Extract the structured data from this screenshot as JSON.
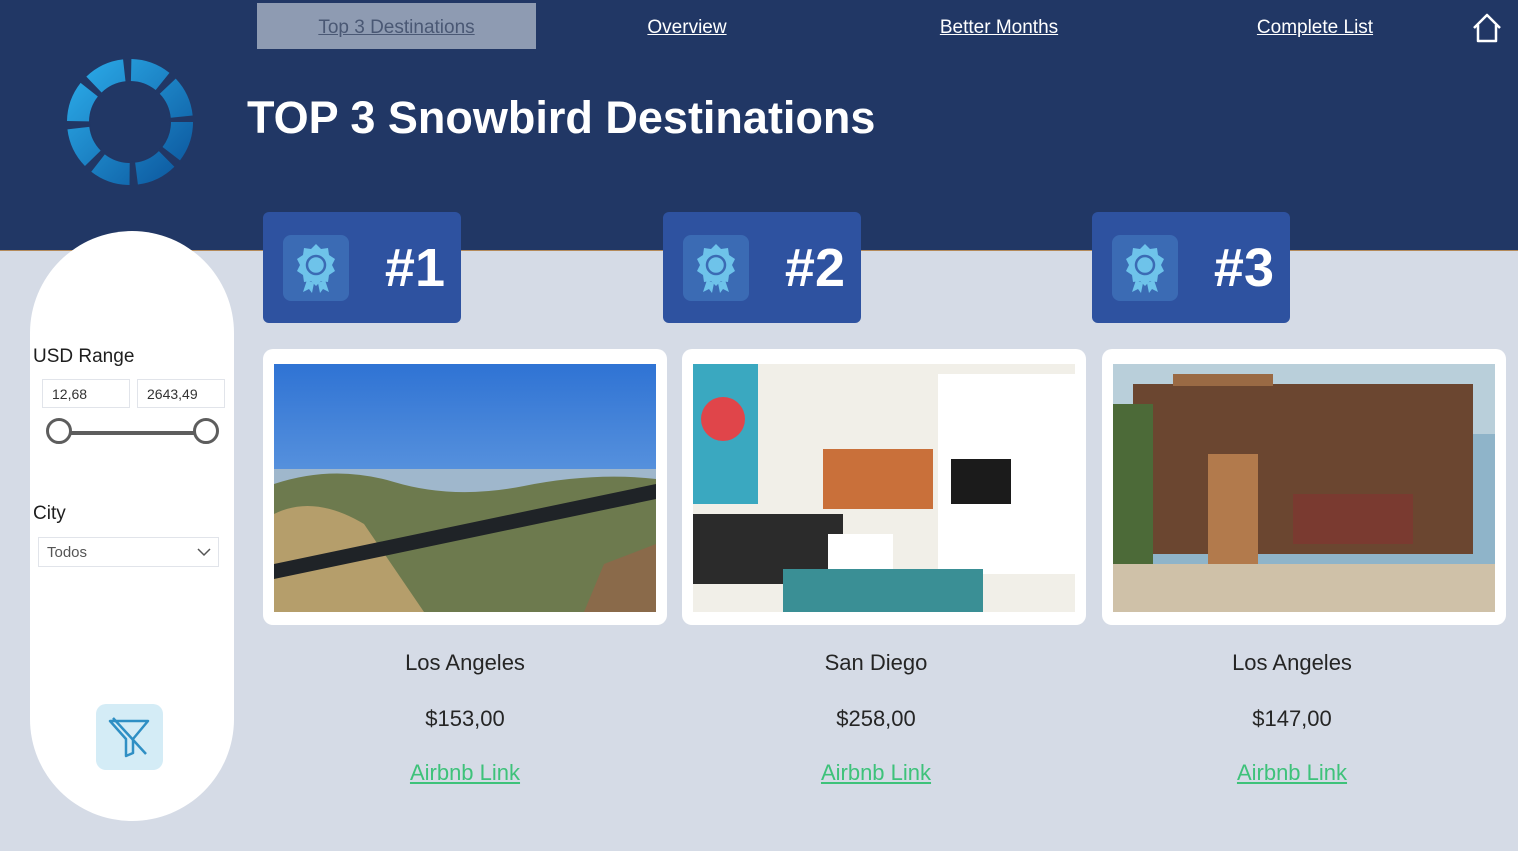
{
  "nav": {
    "items": [
      {
        "label": "Top 3 Destinations",
        "active": true
      },
      {
        "label": "Overview"
      },
      {
        "label": "Better Months"
      },
      {
        "label": "Complete List"
      }
    ],
    "home_icon": "home-icon"
  },
  "header": {
    "title": "TOP 3 Snowbird Destinations",
    "logo_icon": "refresh-cycle-logo"
  },
  "filters": {
    "usd_range": {
      "label": "USD Range",
      "min": "12,68",
      "max": "2643,49"
    },
    "city": {
      "label": "City",
      "value": "Todos"
    },
    "clear_icon": "clear-filter-icon"
  },
  "destinations": [
    {
      "rank": "#1",
      "city": "Los Angeles",
      "price": "$153,00",
      "link": "Airbnb Link",
      "photo": "hillside-ocean-view"
    },
    {
      "rank": "#2",
      "city": "San Diego",
      "price": "$258,00",
      "link": "Airbnb Link",
      "photo": "living-room-interior"
    },
    {
      "rank": "#3",
      "city": "Los Angeles",
      "price": "$147,00",
      "link": "Airbnb Link",
      "photo": "bungalow-wooden-gate"
    }
  ],
  "colors": {
    "header_bg": "#213765",
    "page_bg": "#d5dbe6",
    "rank_card": "#2e52a0",
    "link": "#3ec27a",
    "award_icon": "#6ec3ea"
  }
}
